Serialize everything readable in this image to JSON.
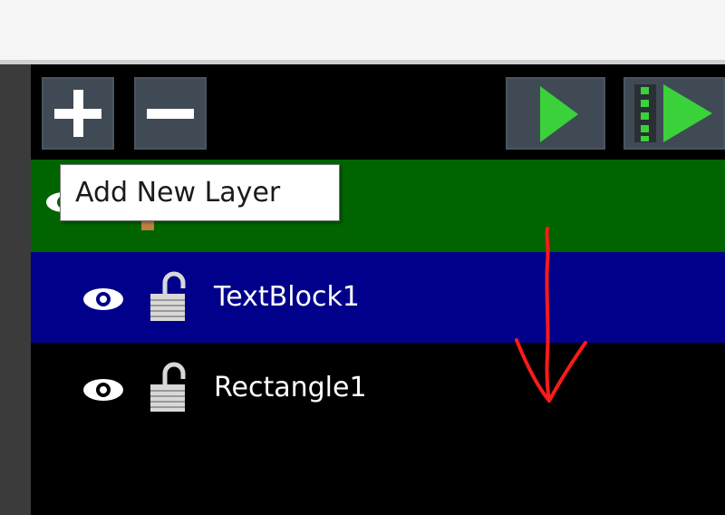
{
  "toolbar": {
    "add_layer": {
      "icon": "plus-icon"
    },
    "remove_layer": {
      "icon": "minus-icon"
    },
    "play": {
      "icon": "play-icon"
    },
    "play_frames": {
      "icon": "play-frames-icon"
    }
  },
  "tooltip": {
    "text": "Add New Layer"
  },
  "layers": [
    {
      "name": "",
      "visible": true,
      "locked": false,
      "state": "group"
    },
    {
      "name": "TextBlock1",
      "visible": true,
      "locked": false,
      "state": "selected"
    },
    {
      "name": "Rectangle1",
      "visible": true,
      "locked": false,
      "state": "normal"
    }
  ],
  "colors": {
    "panel_bg": "#000000",
    "group_row": "#006400",
    "selected_row": "#00008b",
    "button_bg": "#3f4a55",
    "play_green": "#3ad13a",
    "annotation_red": "#ff1a1a"
  }
}
